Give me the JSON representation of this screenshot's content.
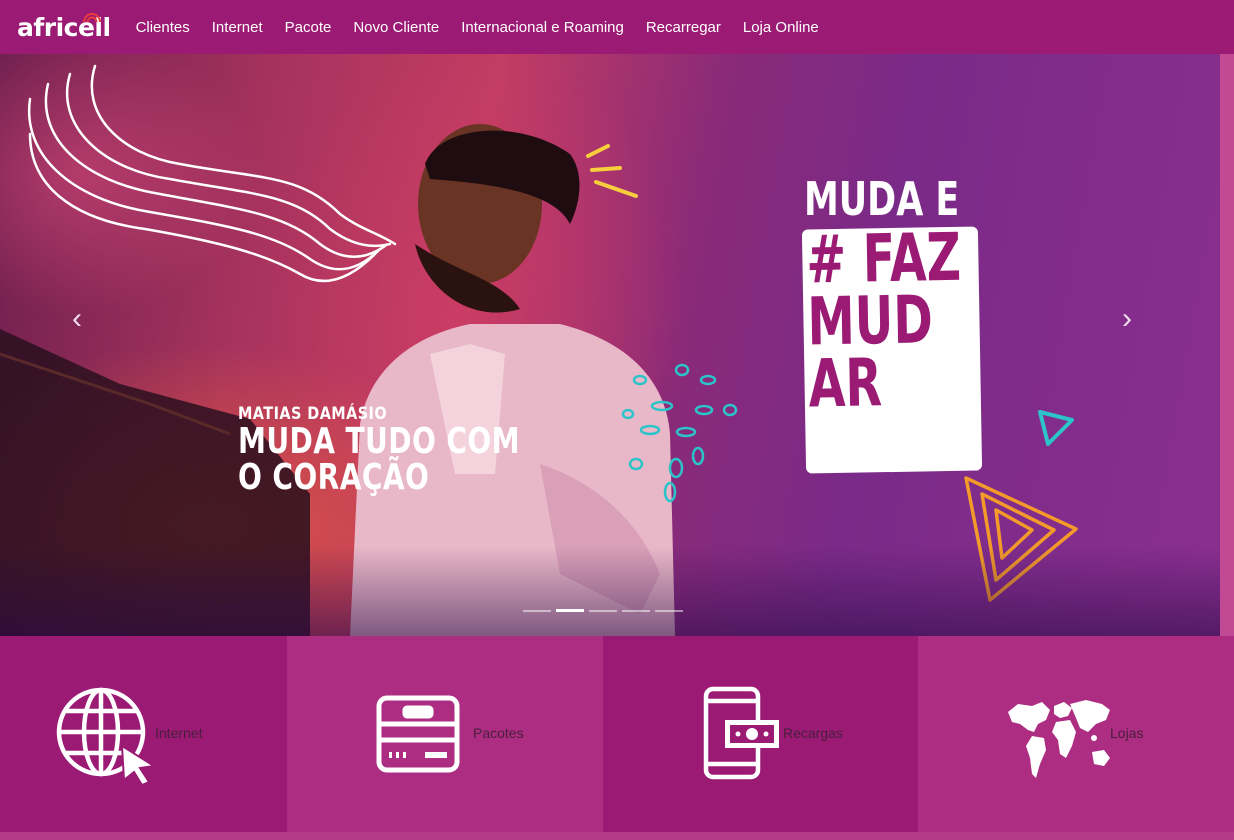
{
  "brand": {
    "logo_text": "africell",
    "logo_icon": "signal-waves-icon"
  },
  "nav": {
    "items": [
      {
        "label": "Clientes"
      },
      {
        "label": "Internet"
      },
      {
        "label": "Pacote"
      },
      {
        "label": "Novo Cliente"
      },
      {
        "label": "Internacional e Roaming"
      },
      {
        "label": "Recarregar"
      },
      {
        "label": "Loja Online"
      }
    ]
  },
  "hero": {
    "caption_name": "MATIAS DAMÁSIO",
    "caption_line1": "MUDA TUDO COM",
    "caption_line2": "O CORAÇÃO",
    "campaign_top": "MUDA E",
    "campaign_lines": [
      "# FAZ",
      "MUD",
      "AR"
    ],
    "prev_icon": "chevron-left-icon",
    "next_icon": "chevron-right-icon",
    "prev_glyph": "‹",
    "next_glyph": "›",
    "slide_count": 5,
    "active_slide": 2
  },
  "tiles": [
    {
      "label": "Internet",
      "icon": "globe-cursor-icon"
    },
    {
      "label": "Pacotes",
      "icon": "package-box-icon"
    },
    {
      "label": "Recargas",
      "icon": "phone-money-icon"
    },
    {
      "label": "Lojas",
      "icon": "world-map-icon"
    }
  ],
  "colors": {
    "brand_purple": "#9b1a74",
    "tile_alt": "#ac2d81",
    "accent_teal": "#2cc3c9",
    "accent_orange": "#f39a2a",
    "accent_yellow": "#f7cf3d"
  }
}
